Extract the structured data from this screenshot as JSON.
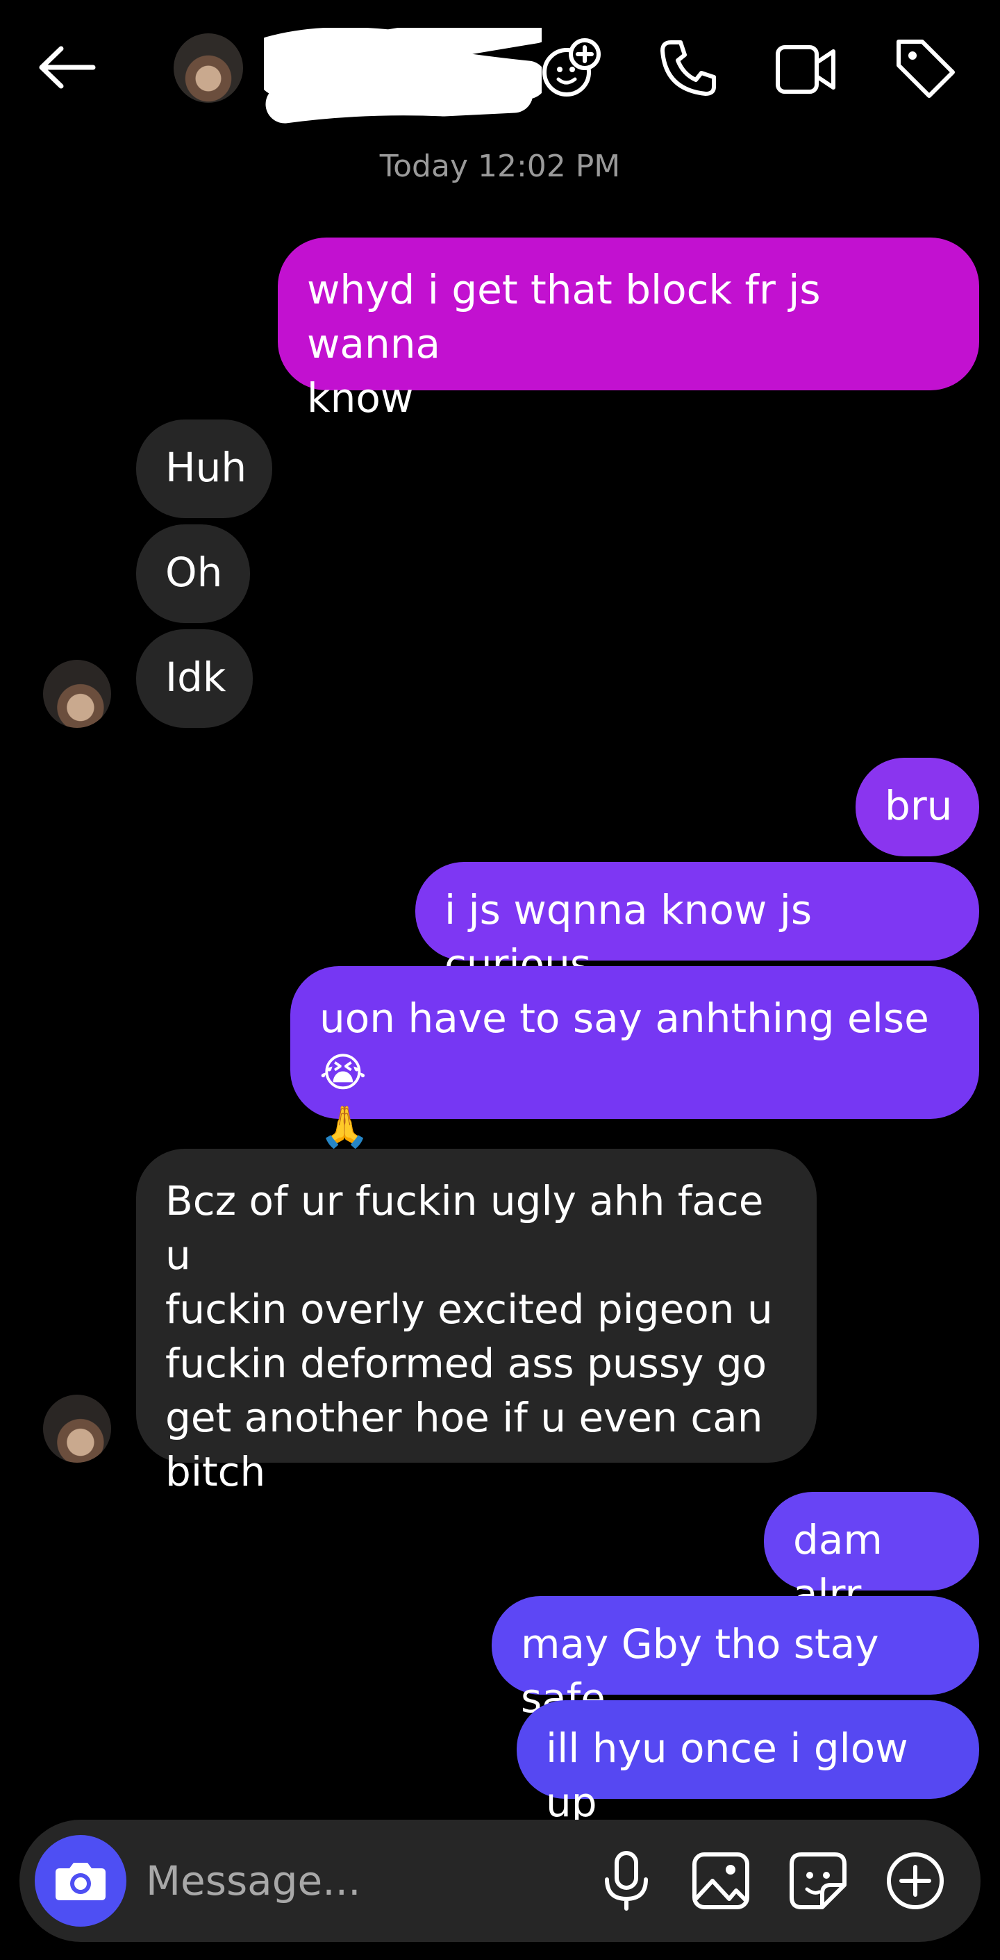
{
  "header": {
    "contact_name_redacted": true,
    "icons": [
      "back-arrow-icon",
      "effects-icon",
      "phone-icon",
      "video-icon",
      "tag-icon"
    ]
  },
  "timestamp": "Today 12:02 PM",
  "messages": [
    {
      "dir": "out",
      "text": "whyd i get that block fr js wanna\nknow",
      "color": "#c211d0"
    },
    {
      "dir": "in",
      "text": "Huh"
    },
    {
      "dir": "in",
      "text": "Oh"
    },
    {
      "dir": "in",
      "text": "Idk"
    },
    {
      "dir": "out",
      "text": "bru",
      "color": "#8a35ef"
    },
    {
      "dir": "out",
      "text": "i js wqnna know js curious",
      "color": "#7e37f3"
    },
    {
      "dir": "out",
      "text": "uon have to say anhthing else😭\n🙏",
      "color": "#7637f3"
    },
    {
      "dir": "in",
      "text": "Bcz of ur fuckin ugly ahh face u\nfuckin overly excited pigeon u\nfuckin deformed ass pussy go\nget another hoe if u even can\nbitch"
    },
    {
      "dir": "out",
      "text": "dam alrr",
      "color": "#6844f5"
    },
    {
      "dir": "out",
      "text": "may Gby tho stay safe",
      "color": "#5d47f5"
    },
    {
      "dir": "out",
      "text": "ill hyu once i glow up",
      "color": "#5648f2"
    }
  ],
  "composer": {
    "placeholder": "Message...",
    "icons": [
      "camera-icon",
      "microphone-icon",
      "gallery-icon",
      "sticker-icon",
      "plus-icon"
    ],
    "camera_color": "#4e4ff3"
  }
}
